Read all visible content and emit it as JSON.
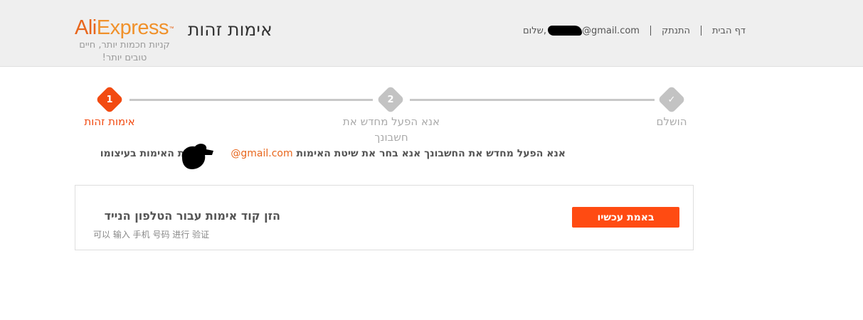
{
  "header": {
    "logo_ali": "Ali",
    "logo_express": "Express",
    "logo_tm": "™",
    "page_title": "אימות זהות",
    "tagline": "קניות חכמות יותר, חיים טובים יותר!"
  },
  "topnav": {
    "home": "דף הבית",
    "logout": "התנתק",
    "greeting_prefix": "שלום,",
    "greeting_email_suffix": "@gmail.com"
  },
  "steps": [
    {
      "number": "1",
      "label": "אימות זהות",
      "state": "active"
    },
    {
      "number": "2",
      "label": "אנא הפעל מחדש את חשבונך",
      "state": "pending"
    },
    {
      "number": "✓",
      "label": "הושלם",
      "state": "pending"
    }
  ],
  "colors": {
    "accent": "#ff4b12",
    "active_step": "#f24b12",
    "inactive_step": "#c3c3c3",
    "brand_orange": "#e8661c"
  },
  "instructions": {
    "text": "אנא הפעל מחדש את החשבונך אנא בחר את שיטת האימות",
    "email": "@gmail.com",
    "tail": "שרת האימות בעיצומו"
  },
  "verify_option": {
    "title": "הזן קוד אימות עבור הטלפון הנייד",
    "subtitle": "可以 输入 手机 号码 进行 验证",
    "button_label": "באמת עכשיו"
  }
}
